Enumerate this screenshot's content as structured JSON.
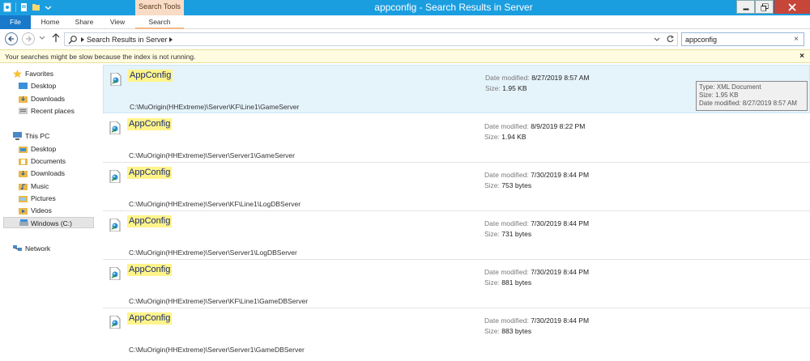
{
  "window": {
    "title": "appconfig - Search Results in Server",
    "contextual_tab": "Search Tools"
  },
  "ribbon": {
    "tabs": [
      "File",
      "Home",
      "Share",
      "View",
      "Search"
    ]
  },
  "address": {
    "crumb": "Search Results in Server"
  },
  "search": {
    "value": "appconfig",
    "clear_label": "×"
  },
  "infobar": {
    "message": "Your searches might be slow because the index is not running.",
    "close_label": "×"
  },
  "nav": {
    "favorites": {
      "label": "Favorites",
      "items": [
        "Desktop",
        "Downloads",
        "Recent places"
      ]
    },
    "this_pc": {
      "label": "This PC",
      "items": [
        "Desktop",
        "Documents",
        "Downloads",
        "Music",
        "Pictures",
        "Videos",
        "Windows (C:)"
      ]
    },
    "network": {
      "label": "Network"
    }
  },
  "labels": {
    "date_modified": "Date modified:",
    "size": "Size:"
  },
  "results": [
    {
      "name": "AppConfig",
      "path": "C:\\MuOrigin(HHExtreme)\\Server\\KF\\Line1\\GameServer",
      "date": "8/27/2019 8:57 AM",
      "size": "1.95 KB"
    },
    {
      "name": "AppConfig",
      "path": "C:\\MuOrigin(HHExtreme)\\Server\\Server1\\GameServer",
      "date": "8/9/2019 8:22 PM",
      "size": "1.94 KB"
    },
    {
      "name": "AppConfig",
      "path": "C:\\MuOrigin(HHExtreme)\\Server\\KF\\Line1\\LogDBServer",
      "date": "7/30/2019 8:44 PM",
      "size": "753 bytes"
    },
    {
      "name": "AppConfig",
      "path": "C:\\MuOrigin(HHExtreme)\\Server\\Server1\\LogDBServer",
      "date": "7/30/2019 8:44 PM",
      "size": "731 bytes"
    },
    {
      "name": "AppConfig",
      "path": "C:\\MuOrigin(HHExtreme)\\Server\\KF\\Line1\\GameDBServer",
      "date": "7/30/2019 8:44 PM",
      "size": "881 bytes"
    },
    {
      "name": "AppConfig",
      "path": "C:\\MuOrigin(HHExtreme)\\Server\\Server1\\GameDBServer",
      "date": "7/30/2019 8:44 PM",
      "size": "883 bytes"
    }
  ],
  "tooltip": {
    "type": "Type: XML Document",
    "size": "Size: 1.95 KB",
    "date": "Date modified: 8/27/2019 8:57 AM"
  },
  "colors": {
    "titlebar": "#1b9ee0",
    "file_tab": "#1979ca",
    "search_tools": "#f8dcc6",
    "highlight": "#fff48a",
    "selected_row": "#e5f3fb",
    "infobar": "#fffce0",
    "close": "#c7463a"
  }
}
